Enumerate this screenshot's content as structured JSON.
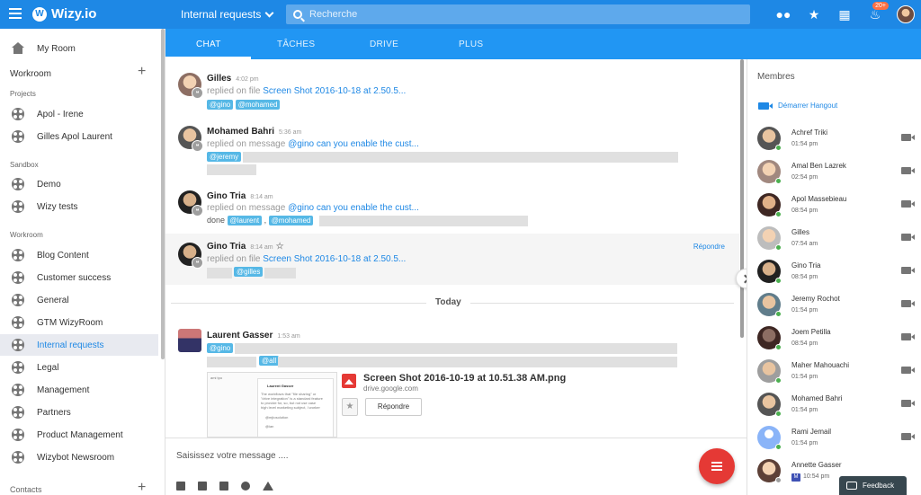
{
  "app": {
    "name": "Wizy.io"
  },
  "header": {
    "room": "Internal requests",
    "search_placeholder": "Recherche",
    "notif_count": "20+"
  },
  "sidebar": {
    "my_room": "My Room",
    "workroom_label": "Workroom",
    "projects_label": "Projects",
    "projects": [
      "Apol - Irene",
      "Gilles Apol Laurent"
    ],
    "sandbox_label": "Sandbox",
    "sandbox": [
      "Demo",
      "Wizy tests"
    ],
    "workroom_sub_label": "Workroom",
    "workroom": [
      "Blog Content",
      "Customer success",
      "General",
      "GTM WizyRoom",
      "Internal requests",
      "Legal",
      "Management",
      "Partners",
      "Product Management",
      "Wizybot Newsroom"
    ],
    "contacts_label": "Contacts"
  },
  "tabs": [
    "CHAT",
    "TÂCHES",
    "DRIVE",
    "PLUS"
  ],
  "chat": {
    "messages": [
      {
        "author": "Gilles",
        "time": "4:02 pm",
        "prefix": "replied on file",
        "ref": "Screen Shot 2016-10-18 at 2.50.5...",
        "tags": [
          "@gino",
          "@mohamed"
        ]
      },
      {
        "author": "Mohamed Bahri",
        "time": "5:36 am",
        "prefix": "replied on message",
        "ref": "@gino can you enable the cust...",
        "tags": [
          "@jeremy"
        ]
      },
      {
        "author": "Gino Tria",
        "time": "8:14 am",
        "prefix": "replied on message",
        "ref": "@gino can you enable the cust...",
        "done": "done",
        "tags": [
          "@laurent",
          "@mohamed"
        ],
        "sep": ","
      },
      {
        "author": "Gino Tria",
        "time": "8:14 am",
        "prefix": "replied on file",
        "ref": "Screen Shot 2016-10-18 at 2.50.5...",
        "tags": [
          "@gilles"
        ],
        "reply": "Répondre"
      },
      {
        "author": "Laurent Gasser",
        "time": "1:53 am",
        "tags": [
          "@gino",
          "@all"
        ]
      }
    ],
    "today_label": "Today",
    "attachment": {
      "name": "Screen Shot 2016-10-19 at 10.51.38 AM.png",
      "host": "drive.google.com",
      "reply_label": "Répondre",
      "preview_author": "Laurent Gasser"
    }
  },
  "composer": {
    "placeholder": "Saisissez votre message ...."
  },
  "members": {
    "title": "Membres",
    "hangout": "Démarrer Hangout",
    "list": [
      {
        "name": "Achref Triki",
        "time": "01:54 pm"
      },
      {
        "name": "Amal Ben Lazrek",
        "time": "02:54 pm"
      },
      {
        "name": "Apol Massebieau",
        "time": "08:54 pm"
      },
      {
        "name": "Gilles",
        "time": "07:54 am"
      },
      {
        "name": "Gino Tria",
        "time": "08:54 pm"
      },
      {
        "name": "Jeremy Rochot",
        "time": "01:54 pm"
      },
      {
        "name": "Joem Petilla",
        "time": "08:54 pm"
      },
      {
        "name": "Maher Mahouachi",
        "time": "01:54 pm"
      },
      {
        "name": "Mohamed Bahri",
        "time": "01:54 pm"
      },
      {
        "name": "Rami Jemail",
        "time": "01:54 pm"
      },
      {
        "name": "Annette Gasser",
        "time": "10:54 pm",
        "badge": "M"
      }
    ]
  },
  "feedback": "Feedback"
}
